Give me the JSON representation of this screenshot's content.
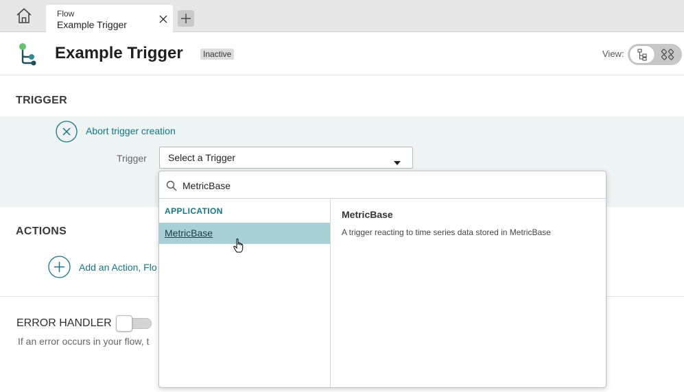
{
  "tabbar": {
    "home_icon": "home-icon",
    "tab": {
      "line1": "Flow",
      "line2": "Example Trigger",
      "close_icon": "close-icon"
    },
    "add_tab_icon": "plus-icon"
  },
  "header": {
    "logo_icon": "flow-logo-icon",
    "title": "Example Trigger",
    "status": "Inactive",
    "view_label": "View:",
    "view_options": [
      "tree-view-icon",
      "grid-view-icon"
    ],
    "selected_view": "tree-view-icon"
  },
  "trigger": {
    "section_title": "TRIGGER",
    "abort_label": "Abort trigger creation",
    "field_label": "Trigger",
    "select_value": "Select a Trigger"
  },
  "dropdown": {
    "search_value": "MetricBase",
    "group_label": "APPLICATION",
    "options": [
      "MetricBase"
    ],
    "selected_option": "MetricBase",
    "detail_title": "MetricBase",
    "detail_description": "A trigger reacting to time series data stored in MetricBase"
  },
  "actions": {
    "section_title": "ACTIONS",
    "add_label": "Add an Action, Flo"
  },
  "error_handler": {
    "title": "ERROR HANDLER",
    "enabled": false,
    "description": "If an error occurs in your flow, t"
  },
  "colors": {
    "accent": "#147588",
    "trigger_band": "#eef3f3",
    "selected_option": "#a9cfd7",
    "logo_green": "#6bbf73",
    "logo_teal": "#2d8c96",
    "logo_dark": "#204d5a"
  }
}
